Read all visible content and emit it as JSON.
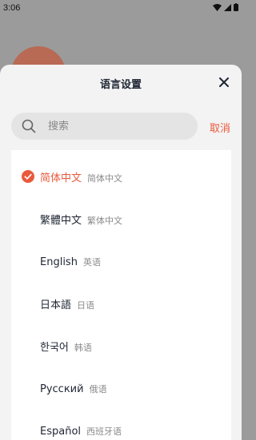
{
  "status": {
    "time": "3:06"
  },
  "sheet": {
    "title": "语言设置",
    "search_placeholder": "搜索",
    "cancel_label": "取消"
  },
  "languages": [
    {
      "name": "简体中文",
      "sub": "简体中文",
      "selected": true
    },
    {
      "name": "繁體中文",
      "sub": "繁体中文",
      "selected": false
    },
    {
      "name": "English",
      "sub": "英语",
      "selected": false
    },
    {
      "name": "日本語",
      "sub": "日语",
      "selected": false
    },
    {
      "name": "한국어",
      "sub": "韩语",
      "selected": false
    },
    {
      "name": "Русский",
      "sub": "俄语",
      "selected": false
    },
    {
      "name": "Español",
      "sub": "西班牙语",
      "selected": false
    }
  ],
  "colors": {
    "accent": "#e95a3b",
    "text": "#1e2533",
    "subtext": "#8a8a8a"
  }
}
